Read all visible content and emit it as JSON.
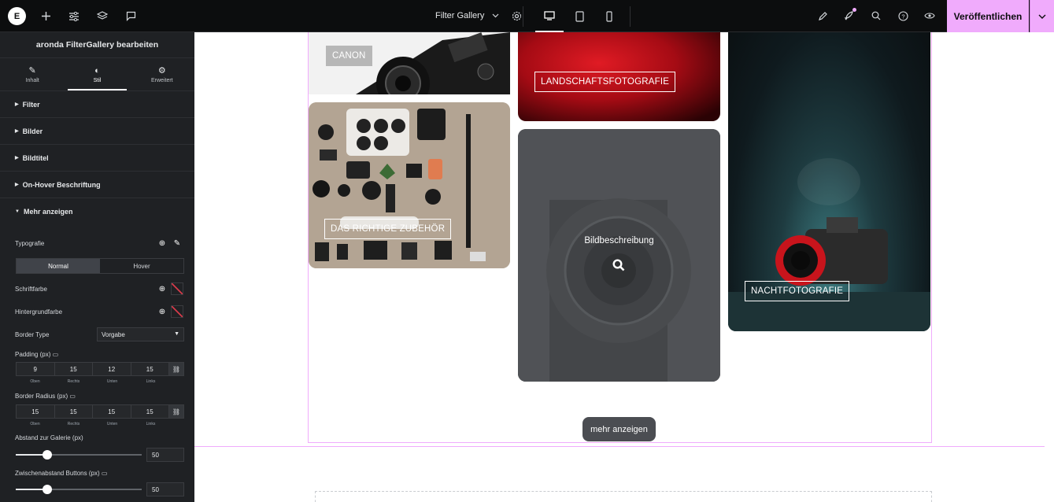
{
  "topbar": {
    "document_title": "Filter Gallery",
    "publish_label": "Veröffentlichen",
    "left_icons": [
      "elementor-logo-icon",
      "plus-icon",
      "sliders-icon",
      "layers-icon",
      "chat-icon"
    ],
    "right_icons": [
      "brush-icon",
      "rocket-icon",
      "search-icon",
      "help-icon",
      "eye-icon"
    ]
  },
  "panel": {
    "title": "aronda FilterGallery bearbeiten",
    "tabs": [
      {
        "label": "Inhalt",
        "icon": "pencil-icon"
      },
      {
        "label": "Stil",
        "icon": "contrast-icon"
      },
      {
        "label": "Erweitert",
        "icon": "gear-icon"
      }
    ],
    "sections": [
      "Filter",
      "Bilder",
      "Bildtitel",
      "On-Hover Beschriftung",
      "Mehr anzeigen"
    ],
    "controls": {
      "typografie": "Typografie",
      "normal": "Normal",
      "hover": "Hover",
      "schriftfarbe": "Schriftfarbe",
      "hintergrundfarbe": "Hintergrundfarbe",
      "border_type": "Border Type",
      "border_type_value": "Vorgabe",
      "padding": "Padding (px)",
      "padding_values": [
        "9",
        "15",
        "12",
        "15"
      ],
      "border_radius": "Border Radius (px)",
      "border_radius_values": [
        "15",
        "15",
        "15",
        "15"
      ],
      "dim_labels": [
        "Oben",
        "Rechts",
        "Unten",
        "Links"
      ],
      "abstand": "Abstand zur Galerie (px)",
      "abstand_value": "50",
      "zwischenabstand": "Zwischenabstand Buttons (px)",
      "zwischenabstand_value": "50"
    }
  },
  "gallery": {
    "captions": {
      "canon": "CANON",
      "landschaft": "LANDSCHAFTSFOTOGRAFIE",
      "zubehoer": "DAS RICHTIGE ZUBEHÖR",
      "bildbeschreibung": "Bildbeschreibung",
      "nacht": "NACHTFOTOGRAFIE"
    },
    "more_button": "mehr anzeigen"
  }
}
